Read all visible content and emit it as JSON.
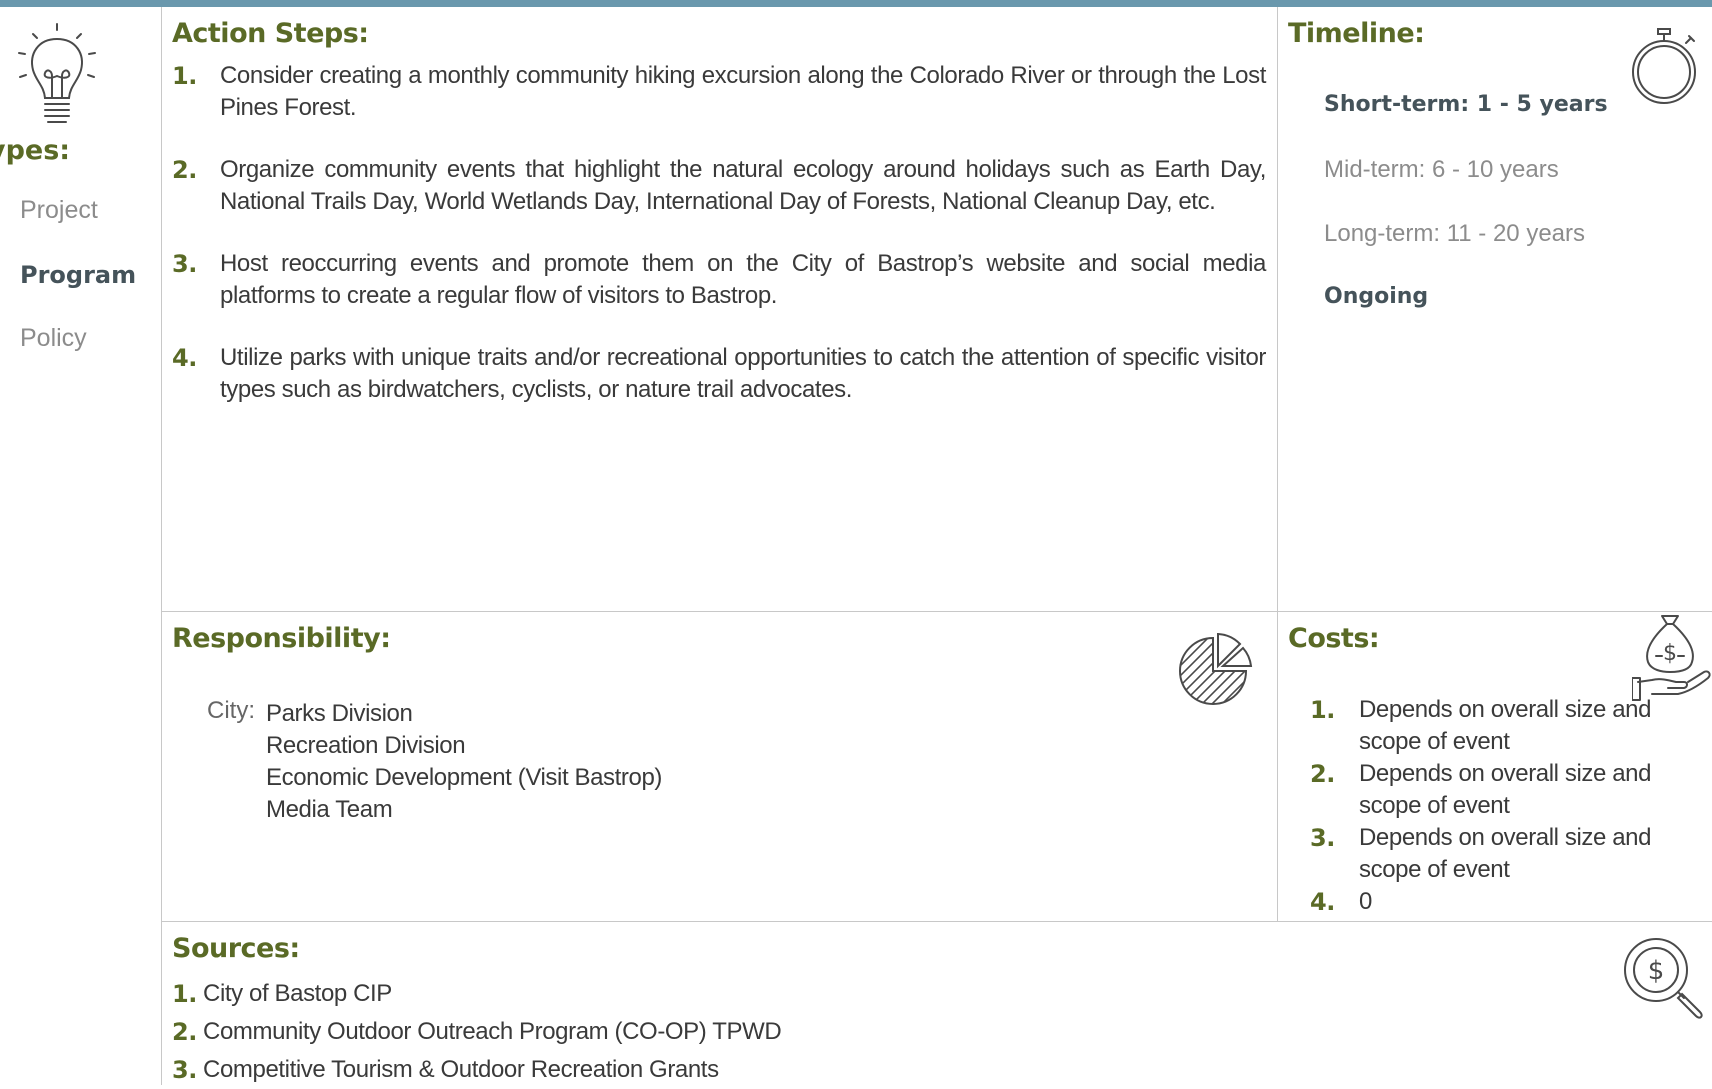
{
  "left": {
    "types_label": "ypes:",
    "items": [
      {
        "label": "Project",
        "active": false
      },
      {
        "label": "Program",
        "active": true
      },
      {
        "label": "Policy",
        "active": false
      }
    ]
  },
  "action_steps": {
    "heading": "Action Steps:",
    "items": [
      {
        "num": "1.",
        "text": "Consider creating a monthly community hiking excursion along the Colorado River or through the Lost Pines Forest."
      },
      {
        "num": "2.",
        "text": "Organize community events that highlight the natural ecology around holidays such as Earth Day, National Trails Day, World Wetlands Day, International Day of Forests, National Cleanup Day, etc."
      },
      {
        "num": "3.",
        "text": "Host reoccurring events and promote them on the City of Bastrop’s website and social media platforms to create a regular flow of visitors to Bastrop."
      },
      {
        "num": "4.",
        "text": "Utilize parks with unique traits and/or recreational opportunities to catch the attention of specific visitor types such as birdwatchers, cyclists, or nature trail advocates."
      }
    ]
  },
  "timeline": {
    "heading": "Timeline:",
    "short_term": "Short-term:  1 - 5 years",
    "mid_term": "Mid-term:  6 - 10 years",
    "long_term": "Long-term:  11 - 20 years",
    "ongoing": "Ongoing"
  },
  "responsibility": {
    "heading": "Responsibility:",
    "city_label": "City:",
    "items": [
      "Parks Division",
      "Recreation Division",
      "Economic Development (Visit Bastrop)",
      "Media Team"
    ]
  },
  "costs": {
    "heading": "Costs:",
    "items": [
      {
        "num": "1.",
        "text": "Depends on overall size and scope of event"
      },
      {
        "num": "2.",
        "text": "Depends on overall size and scope of event"
      },
      {
        "num": "3.",
        "text": "Depends on overall size and scope of event"
      },
      {
        "num": "4.",
        "text": "0"
      }
    ]
  },
  "sources": {
    "heading": "Sources:",
    "items": [
      {
        "num": "1.",
        "text": "City of Bastop CIP"
      },
      {
        "num": "2.",
        "text": "Community Outdoor Outreach Program (CO-OP) TPWD"
      },
      {
        "num": "3.",
        "text": "Competitive Tourism & Outdoor Recreation Grants"
      }
    ]
  },
  "icons": {
    "lightbulb": "lightbulb-icon",
    "stopwatch": "stopwatch-icon",
    "pie_chart": "pie-chart-icon",
    "money_bag": "money-bag-hand-icon",
    "search_dollar": "search-dollar-icon"
  },
  "colors": {
    "accent_bar": "#6a98ad",
    "heading": "#5a6a26",
    "strong_text": "#45535a",
    "muted_text": "#8c8c8c"
  }
}
